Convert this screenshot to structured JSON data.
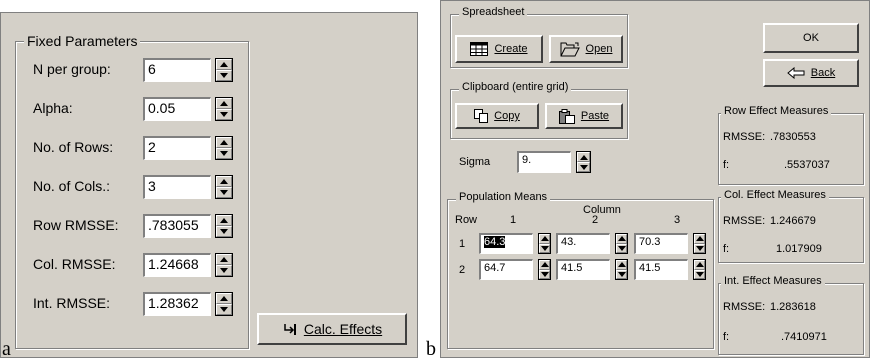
{
  "captions": {
    "a": "a",
    "b": "b"
  },
  "panel_a": {
    "group_title": "Fixed Parameters",
    "rows": [
      {
        "label": "N per group:",
        "value": "6"
      },
      {
        "label": "Alpha:",
        "value": "0.05"
      },
      {
        "label": "No. of Rows:",
        "value": "2"
      },
      {
        "label": "No. of Cols.:",
        "value": "3"
      },
      {
        "label": "Row RMSSE:",
        "value": ".783055"
      },
      {
        "label": "Col. RMSSE:",
        "value": "1.24668"
      },
      {
        "label": "Int. RMSSE:",
        "value": "1.28362"
      }
    ],
    "calc_button": "Calc. Effects"
  },
  "panel_b": {
    "spreadsheet": {
      "title": "Spreadsheet",
      "create": "Create",
      "open": "Open"
    },
    "clipboard": {
      "title": "Clipboard (entire grid)",
      "copy": "Copy",
      "paste": "Paste"
    },
    "ok": "OK",
    "back": "Back",
    "sigma": {
      "label": "Sigma",
      "value": "9."
    },
    "population_means": {
      "title": "Population Means",
      "column_header": "Column",
      "row_header": "Row",
      "columns": [
        "1",
        "2",
        "3"
      ],
      "rows": [
        {
          "label": "1",
          "values": [
            "64.3",
            "43.",
            "70.3"
          ]
        },
        {
          "label": "2",
          "values": [
            "64.7",
            "41.5",
            "41.5"
          ]
        }
      ]
    },
    "row_effect": {
      "title": "Row Effect Measures",
      "rmsse_label": "RMSSE:",
      "rmsse": ".7830553",
      "f_label": "f:",
      "f": ".5537037"
    },
    "col_effect": {
      "title": "Col. Effect Measures",
      "rmsse_label": "RMSSE:",
      "rmsse": "1.246679",
      "f_label": "f:",
      "f": "1.017909"
    },
    "int_effect": {
      "title": "Int. Effect Measures",
      "rmsse_label": "RMSSE:",
      "rmsse": "1.283618",
      "f_label": "f:",
      "f": ".7410971"
    }
  }
}
